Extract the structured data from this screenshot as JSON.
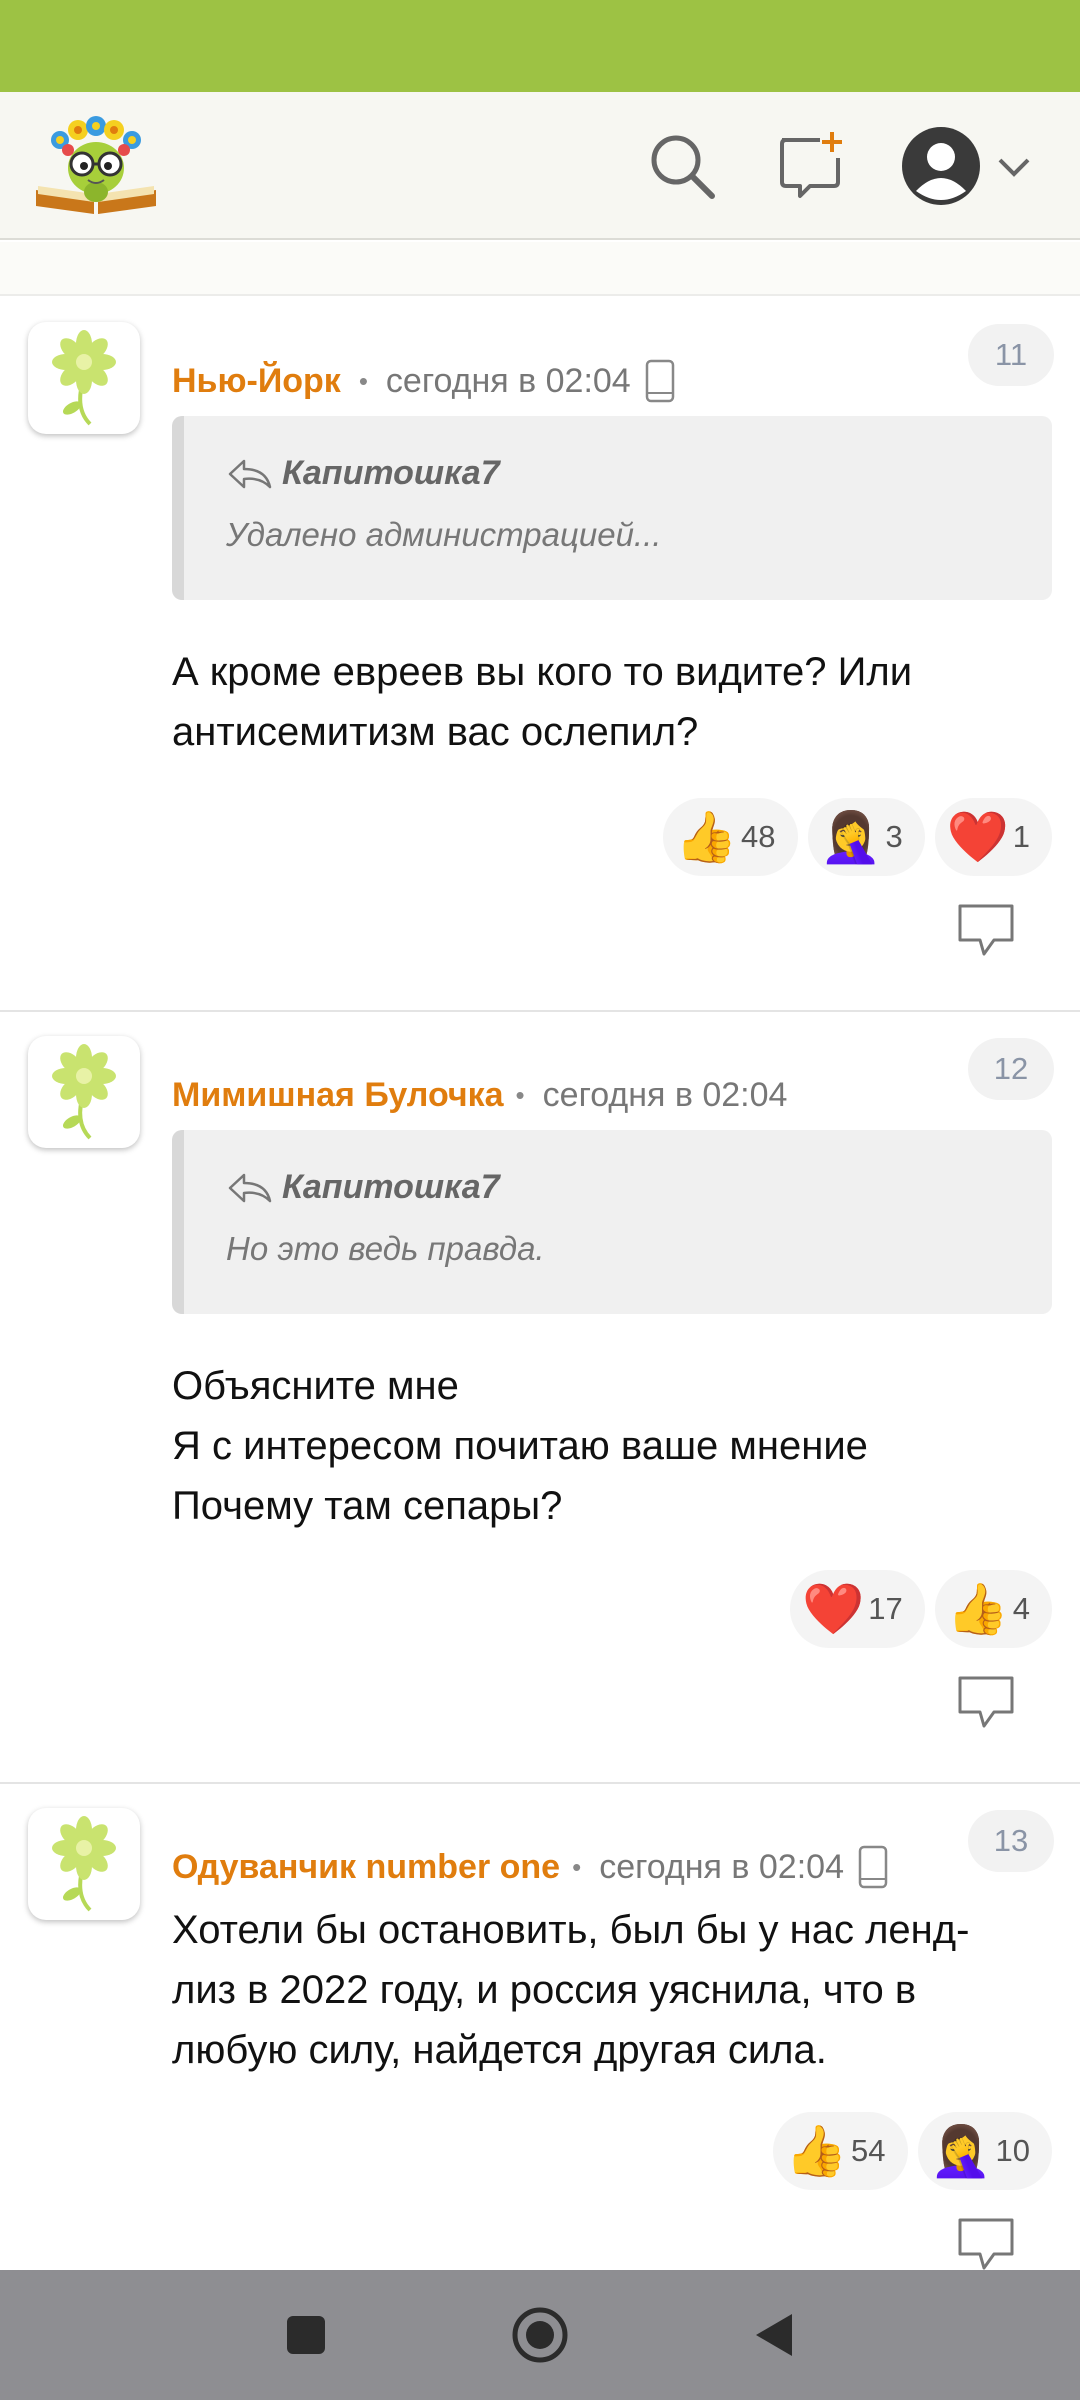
{
  "header": {
    "logo": "bookworm-flower-logo",
    "icons": [
      "search-icon",
      "new-post-icon",
      "account-icon",
      "chevron-down-icon"
    ]
  },
  "colors": {
    "status_bar": "#9dc244",
    "author": "#e07d0e",
    "nav_bar": "#8e8e92"
  },
  "comments": [
    {
      "author": "Нью-Йорк",
      "time": "сегодня в 02:04",
      "device": "mobile-phone-icon",
      "number": "11",
      "quote": {
        "author": "Капитошка7",
        "text": "Удалено администрацией..."
      },
      "body": [
        "А кроме евреев вы кого то видите? Или",
        "антисемитизм вас ослепил?"
      ],
      "reactions": [
        {
          "emoji": "👍",
          "name": "thumbs-up",
          "count": "48"
        },
        {
          "emoji": "🤦‍♀️",
          "name": "facepalm",
          "count": "3"
        },
        {
          "emoji": "❤️",
          "name": "heart",
          "count": "1"
        }
      ]
    },
    {
      "author": "Мимишная Булочка",
      "time": "сегодня в 02:04",
      "device": "",
      "number": "12",
      "quote": {
        "author": "Капитошка7",
        "text": "Но это ведь правда."
      },
      "body": [
        "Объясните мне",
        "Я с интересом почитаю ваше мнение",
        "Почему там сепары?"
      ],
      "reactions": [
        {
          "emoji": "❤️",
          "name": "heart",
          "count": "17"
        },
        {
          "emoji": "👍",
          "name": "thumbs-up",
          "count": "4"
        }
      ]
    },
    {
      "author": "Одуванчик number one",
      "time": "сегодня в 02:04",
      "device": "mobile-phone-icon",
      "number": "13",
      "body": [
        "Хотели бы остановить, был бы у нас ленд-",
        "лиз в 2022 году, и россия уяснила, что в",
        "любую силу, найдется другая сила."
      ],
      "reactions": [
        {
          "emoji": "👍",
          "name": "thumbs-up",
          "count": "54"
        },
        {
          "emoji": "🤦‍♀️",
          "name": "facepalm",
          "count": "10"
        }
      ]
    }
  ],
  "nav": [
    "recents-square-icon",
    "home-circle-icon",
    "back-triangle-icon"
  ]
}
